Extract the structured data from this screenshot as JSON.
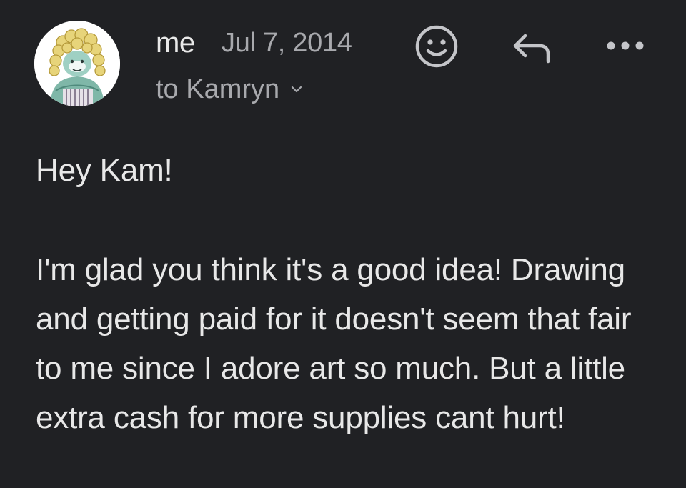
{
  "message": {
    "sender": "me",
    "date": "Jul 7, 2014",
    "recipient": "to Kamryn",
    "greeting": "Hey Kam!",
    "body": "I'm glad you think it's a good idea! Drawing and getting paid for it doesn't seem that fair to me since I adore art so much. But a little extra cash for more supplies cant hurt!"
  },
  "actions": {
    "emoji_icon": "smiley-face-icon",
    "reply_icon": "reply-arrow-icon",
    "more_icon": "more-horizontal-icon",
    "expand_icon": "chevron-down-icon"
  },
  "colors": {
    "background": "#202124",
    "primary_text": "#e8e8e8",
    "secondary_text": "#a8a9ad",
    "icon": "#c4c5c9"
  }
}
